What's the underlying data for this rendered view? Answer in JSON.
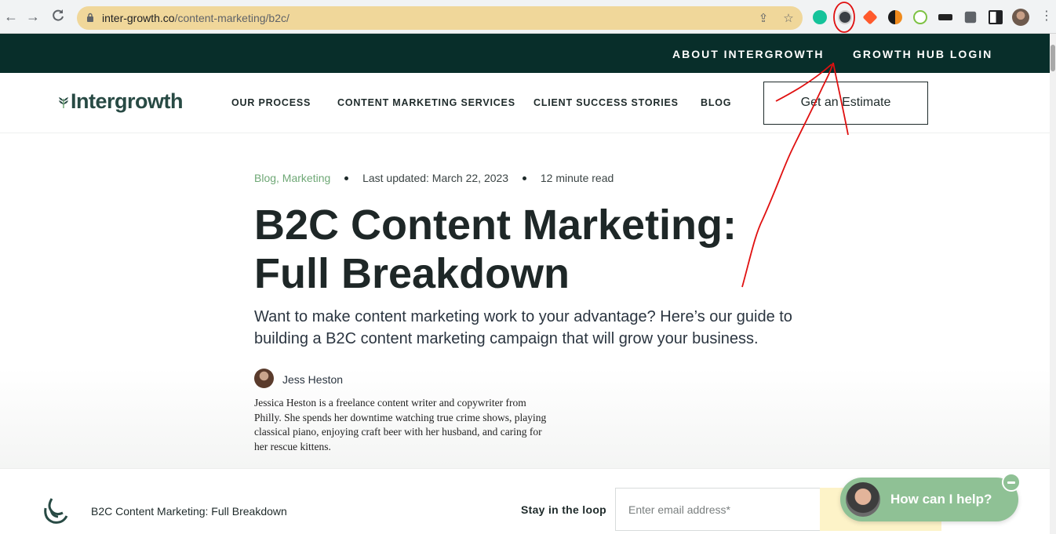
{
  "browser": {
    "url_domain": "inter-growth.co",
    "url_path": "/content-marketing/b2c/",
    "icons": [
      "back-arrow-icon",
      "forward-arrow-icon",
      "reload-icon",
      "lock-icon",
      "share-icon",
      "star-icon",
      "grammarly-icon",
      "extension-k-icon",
      "extension-arrow-icon",
      "extension-moon-icon",
      "extension-50-icon",
      "extension-hh-icon",
      "puzzle-icon",
      "sidepanel-icon",
      "profile-avatar",
      "kebab-menu-icon"
    ]
  },
  "topbar": {
    "about": "ABOUT INTERGROWTH",
    "login": "GROWTH HUB LOGIN"
  },
  "nav": {
    "logo": "Intergrowth",
    "items": [
      "OUR PROCESS",
      "CONTENT MARKETING SERVICES",
      "CLIENT SUCCESS STORIES",
      "BLOG"
    ],
    "cta": "Get an Estimate"
  },
  "article": {
    "categories": "Blog, Marketing",
    "updated": "Last updated: March 22, 2023",
    "read_time": "12 minute read",
    "title": "B2C Content Marketing: Full Breakdown",
    "subtitle": "Want to make content marketing work to your advantage? Here’s our guide to building a B2C content marketing campaign that will grow your business.",
    "author_name": "Jess Heston",
    "author_bio": "Jessica Heston is a freelance content writer and copywriter from Philly. She spends her downtime watching true crime shows, playing classical piano, enjoying craft beer with her husband, and caring for her rescue kittens."
  },
  "sticky": {
    "title": "B2C Content Marketing: Full Breakdown",
    "loop_label": "Stay in the loop",
    "email_placeholder": "Enter email address*"
  },
  "chat": {
    "prompt": "How can I help?"
  },
  "colors": {
    "topbar": "#082e2a",
    "omnibox": "#f0d79a",
    "category_green": "#6fa876",
    "chat_green": "#8fc195",
    "submit_yellow": "#fdf3c8",
    "annotation_red": "#e01010"
  }
}
